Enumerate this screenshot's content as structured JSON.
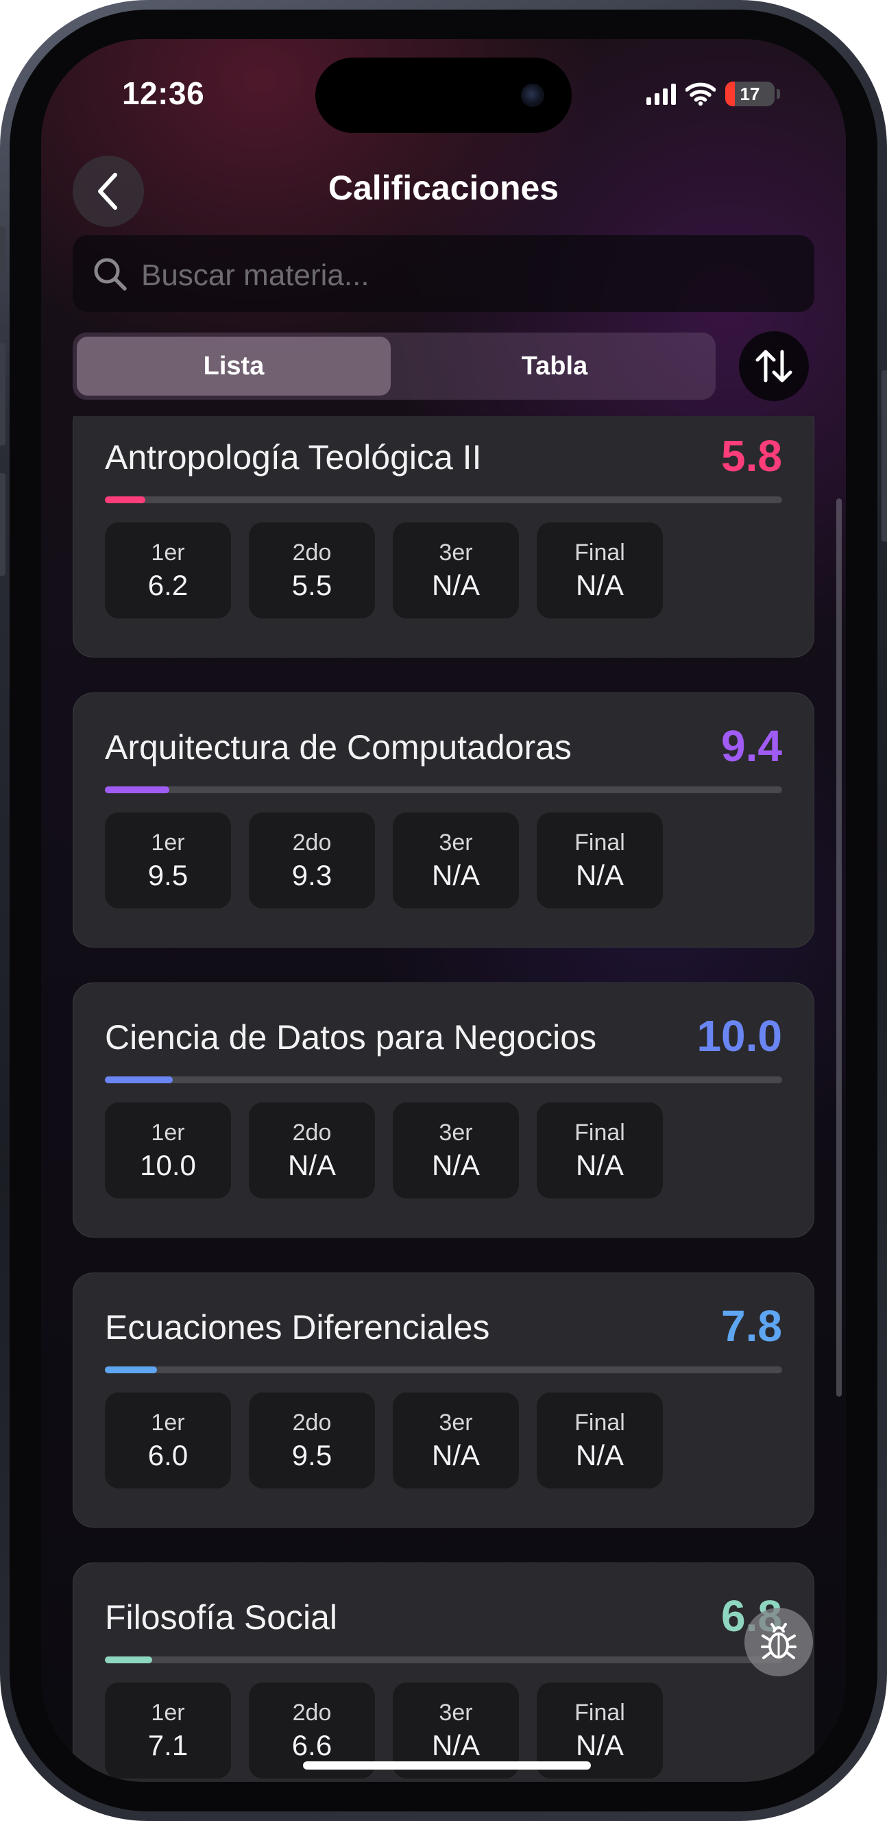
{
  "status_bar": {
    "time": "12:36",
    "battery_level": "17",
    "icons": [
      "signal-icon",
      "wifi-icon",
      "battery-icon"
    ]
  },
  "header": {
    "title": "Calificaciones",
    "back_icon": "chevron-left-icon"
  },
  "search": {
    "placeholder": "Buscar materia...",
    "icon": "search-icon"
  },
  "view_toggle": {
    "options": [
      "Lista",
      "Tabla"
    ],
    "selected": "Lista"
  },
  "sort_button": {
    "icon": "sort-arrows-icon"
  },
  "subjects": [
    {
      "name": "Antropología Teológica II",
      "average": "5.8",
      "color": "#ff3d7a",
      "progress": 0.06,
      "grades": [
        {
          "label": "1er",
          "value": "6.2"
        },
        {
          "label": "2do",
          "value": "5.5"
        },
        {
          "label": "3er",
          "value": "N/A"
        },
        {
          "label": "Final",
          "value": "N/A"
        }
      ]
    },
    {
      "name": "Arquitectura de Computadoras",
      "average": "9.4",
      "color": "#a05cf5",
      "progress": 0.095,
      "grades": [
        {
          "label": "1er",
          "value": "9.5"
        },
        {
          "label": "2do",
          "value": "9.3"
        },
        {
          "label": "3er",
          "value": "N/A"
        },
        {
          "label": "Final",
          "value": "N/A"
        }
      ]
    },
    {
      "name": "Ciencia de Datos para Negocios",
      "average": "10.0",
      "color": "#6a86f5",
      "progress": 0.1,
      "grades": [
        {
          "label": "1er",
          "value": "10.0"
        },
        {
          "label": "2do",
          "value": "N/A"
        },
        {
          "label": "3er",
          "value": "N/A"
        },
        {
          "label": "Final",
          "value": "N/A"
        }
      ]
    },
    {
      "name": "Ecuaciones Diferenciales",
      "average": "7.8",
      "color": "#5ea6f2",
      "progress": 0.077,
      "grades": [
        {
          "label": "1er",
          "value": "6.0"
        },
        {
          "label": "2do",
          "value": "9.5"
        },
        {
          "label": "3er",
          "value": "N/A"
        },
        {
          "label": "Final",
          "value": "N/A"
        }
      ]
    },
    {
      "name": "Filosofía Social",
      "average": "6.8",
      "color": "#8fd6c0",
      "progress": 0.07,
      "grades": [
        {
          "label": "1er",
          "value": "7.1"
        },
        {
          "label": "2do",
          "value": "6.6"
        },
        {
          "label": "3er",
          "value": "N/A"
        },
        {
          "label": "Final",
          "value": "N/A"
        }
      ]
    }
  ],
  "debug_button": {
    "icon": "bug-icon"
  }
}
